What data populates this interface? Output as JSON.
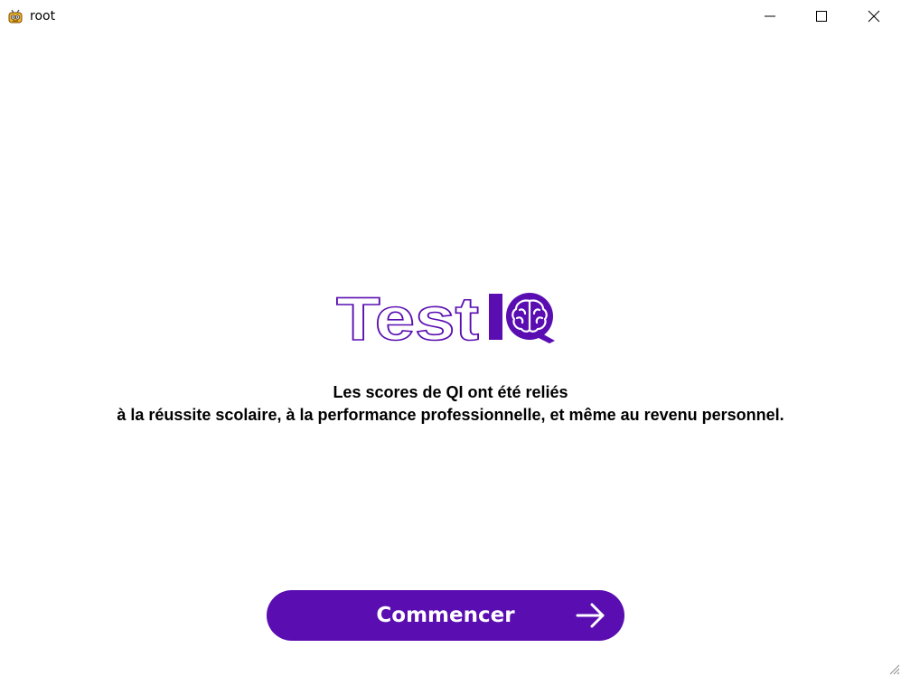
{
  "window": {
    "title": "root",
    "icon": "app-robot-icon",
    "controls": [
      "minimize-icon",
      "maximize-icon",
      "close-icon"
    ]
  },
  "logo": {
    "text_outline": "Test",
    "text_solid": "IQ",
    "brain_icon": "brain-icon",
    "color": "#5a0db1"
  },
  "message": {
    "line1": "Les scores de QI ont été reliés",
    "line2": "à la réussite scolaire, à la performance professionnelle, et même au revenu personnel."
  },
  "start_button": {
    "label": "Commencer",
    "icon": "arrow-right-icon",
    "color": "#5a0db1"
  }
}
